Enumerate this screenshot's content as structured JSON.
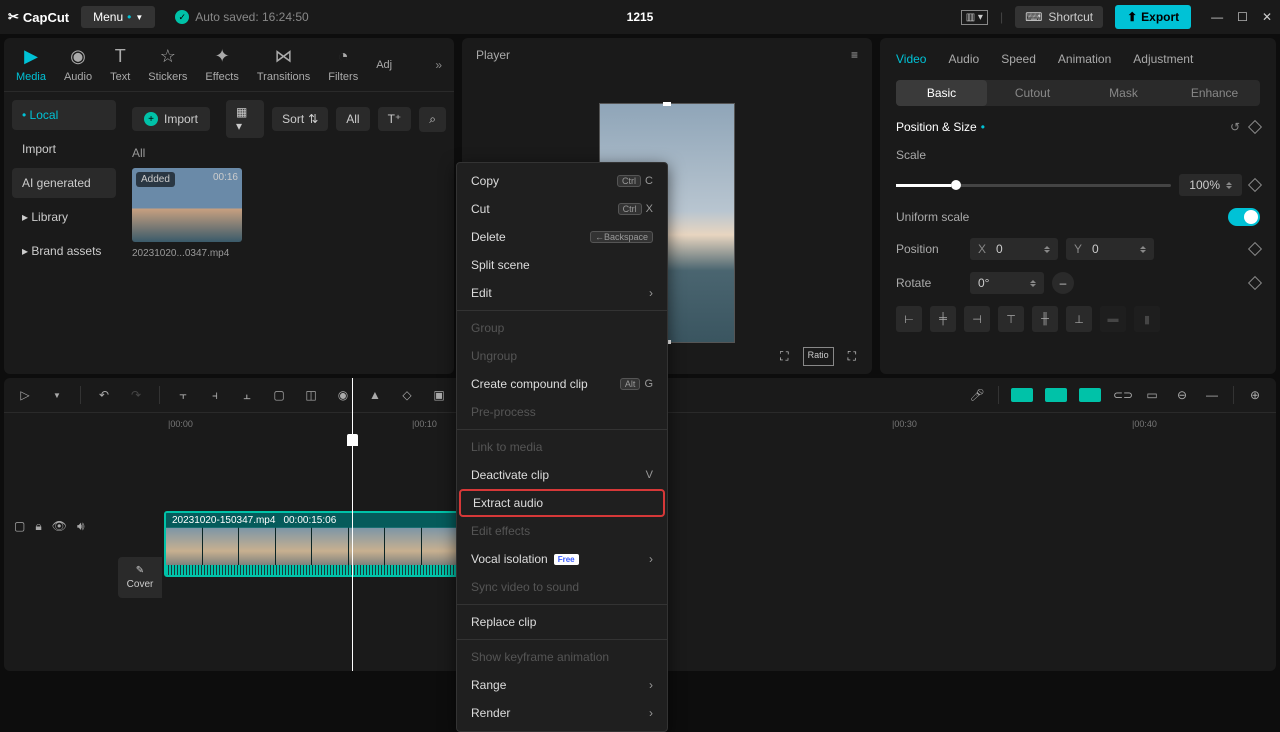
{
  "titlebar": {
    "logo": "CapCut",
    "menu": "Menu",
    "autosave": "Auto saved: 16:24:50",
    "title": "1215",
    "shortcut": "Shortcut",
    "export": "Export"
  },
  "topTabs": {
    "media": "Media",
    "audio": "Audio",
    "text": "Text",
    "stickers": "Stickers",
    "effects": "Effects",
    "transitions": "Transitions",
    "filters": "Filters",
    "adj": "Adj"
  },
  "mediaSidebar": {
    "local": "Local",
    "import": "Import",
    "aigen": "AI generated",
    "library": "Library",
    "brand": "Brand assets"
  },
  "mediaToolbar": {
    "import": "Import",
    "sort": "Sort",
    "all": "All",
    "allLabel": "All"
  },
  "thumb": {
    "added": "Added",
    "duration": "00:16",
    "name": "20231020...0347.mp4"
  },
  "player": {
    "title": "Player",
    "ratio": "Ratio"
  },
  "propTabs": {
    "video": "Video",
    "audio": "Audio",
    "speed": "Speed",
    "animation": "Animation",
    "adjustment": "Adjustment"
  },
  "subTabs": {
    "basic": "Basic",
    "cutout": "Cutout",
    "mask": "Mask",
    "enhance": "Enhance"
  },
  "props": {
    "section": "Position & Size",
    "scale": "Scale",
    "scaleVal": "100%",
    "uniform": "Uniform scale",
    "position": "Position",
    "x": "X",
    "xVal": "0",
    "y": "Y",
    "yVal": "0",
    "rotate": "Rotate",
    "rotateVal": "0°"
  },
  "timeline": {
    "ticks": [
      "|00:00",
      "|00:10",
      "|00:30",
      "|00:40"
    ],
    "cover": "Cover",
    "clipName": "20231020-150347.mp4",
    "clipDur": "00:00:15:06"
  },
  "ctx": {
    "copy": "Copy",
    "copyKey": "C",
    "cut": "Cut",
    "cutKey": "X",
    "delete": "Delete",
    "deleteKey": "Backspace",
    "split": "Split scene",
    "edit": "Edit",
    "group": "Group",
    "ungroup": "Ungroup",
    "compound": "Create compound clip",
    "compoundKey": "G",
    "preprocess": "Pre-process",
    "link": "Link to media",
    "deactivate": "Deactivate clip",
    "deactivateKey": "V",
    "extract": "Extract audio",
    "editfx": "Edit effects",
    "vocal": "Vocal isolation",
    "free": "Free",
    "sync": "Sync video to sound",
    "replace": "Replace clip",
    "keyframe": "Show keyframe animation",
    "range": "Range",
    "render": "Render"
  }
}
